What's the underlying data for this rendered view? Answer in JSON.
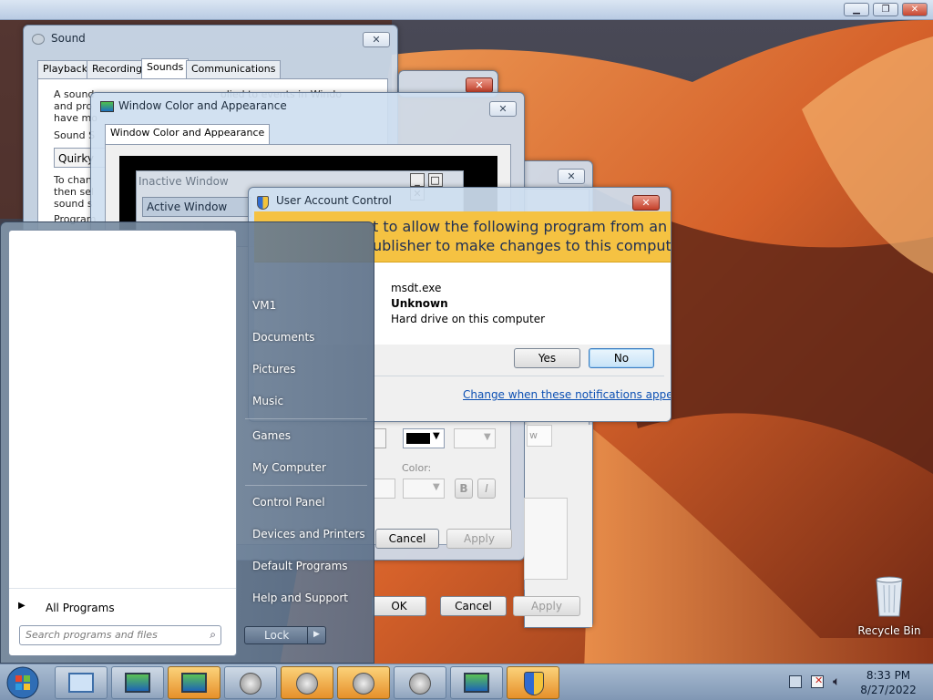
{
  "host": {
    "minimize_icon": "minimize-icon",
    "restore_icon": "restore-icon",
    "close_icon": "close-icon"
  },
  "sound_window": {
    "title": "Sound",
    "tabs": [
      "Playback",
      "Recording",
      "Sounds",
      "Communications"
    ],
    "selected_tab": "Sounds",
    "text_lines": [
      "A sound",
      "and pro",
      "have mo"
    ],
    "text_lines_right": [
      "olied to events in Windo"
    ],
    "label_sound_scheme": "Sound S",
    "scheme_value": "Quirky",
    "text_lines_2": [
      "To chan",
      "then sel",
      "sound s"
    ],
    "label_program": "Program"
  },
  "window_color": {
    "title": "Window Color and Appearance",
    "tab": "Window Color and Appearance",
    "preview_inactive": "Inactive Window",
    "preview_active": "Active Window",
    "color_label": "Color:",
    "bold_label": "B",
    "italic_label": "I",
    "cancel_label": "Cancel",
    "apply_label": "Apply"
  },
  "back_dialog": {
    "ok_label": "OK",
    "cancel_label": "Cancel",
    "apply_label": "Apply",
    "partial_label": "w"
  },
  "uac": {
    "title": "User Account Control",
    "question_line1": "t to allow the following program from an",
    "question_line2": "ublisher to make changes to this computer?",
    "program_name": "msdt.exe",
    "publisher": "Unknown",
    "origin": "Hard drive on this computer",
    "yes_label": "Yes",
    "no_label": "No",
    "link": "Change when these notifications appear"
  },
  "start_menu": {
    "items": [
      "VM1",
      "Documents",
      "Pictures",
      "Music",
      "Games",
      "My Computer",
      "Control Panel",
      "Devices and Printers",
      "Default Programs",
      "Help and Support"
    ],
    "all_programs": "All Programs",
    "search_placeholder": "Search programs and files",
    "lock_label": "Lock"
  },
  "desktop": {
    "recycle_bin_label": "Recycle Bin"
  },
  "taskbar": {
    "time": "8:33 PM",
    "date": "8/27/2022",
    "buttons": [
      "start-orb",
      "server-manager-icon",
      "display-icon",
      "display-icon",
      "speaker-icon",
      "speaker-icon",
      "speaker-icon",
      "speaker-icon",
      "display-icon",
      "shield-icon"
    ]
  }
}
